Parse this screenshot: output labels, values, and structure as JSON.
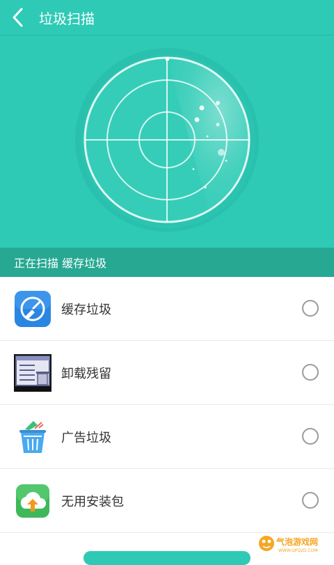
{
  "header": {
    "title": "垃圾扫描"
  },
  "status": {
    "text": "正在扫描 缓存垃圾"
  },
  "items": [
    {
      "label": "缓存垃圾",
      "icon": "broom-clean-icon"
    },
    {
      "label": "卸载残留",
      "icon": "uninstall-list-icon"
    },
    {
      "label": "广告垃圾",
      "icon": "ad-trash-icon"
    },
    {
      "label": "无用安装包",
      "icon": "cloud-upload-package-icon"
    }
  ],
  "watermark": {
    "text": "气泡游戏网",
    "sub": "WWW.QPQ2D.COM"
  },
  "colors": {
    "primary": "#2ecab6",
    "status": "#27a893",
    "icon_blue": "#2a86e0"
  }
}
